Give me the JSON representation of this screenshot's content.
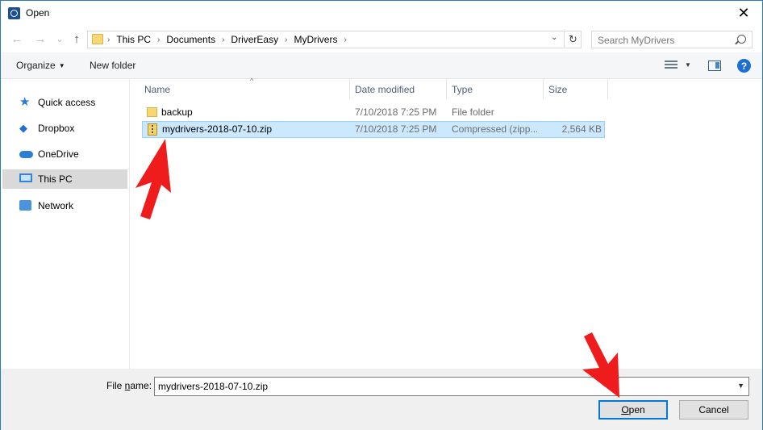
{
  "window": {
    "title": "Open",
    "close_glyph": "✕"
  },
  "nav_buttons": {
    "back": "←",
    "forward": "→",
    "recent": "⌄",
    "up": "↑"
  },
  "address": {
    "crumbs": [
      "This PC",
      "Documents",
      "DriverEasy",
      "MyDrivers"
    ],
    "separator": "›",
    "refresh_glyph": "↻"
  },
  "search": {
    "placeholder": "Search MyDrivers"
  },
  "toolbar": {
    "organize": "Organize",
    "new_folder": "New folder",
    "help": "?"
  },
  "nav_pane": {
    "items": [
      {
        "label": "Quick access",
        "icon": "star-icon"
      },
      {
        "label": "Dropbox",
        "icon": "dropbox-icon"
      },
      {
        "label": "OneDrive",
        "icon": "cloud-icon"
      },
      {
        "label": "This PC",
        "icon": "computer-icon",
        "selected": true
      },
      {
        "label": "Network",
        "icon": "network-icon"
      }
    ]
  },
  "columns": {
    "name": "Name",
    "date": "Date modified",
    "type": "Type",
    "size": "Size"
  },
  "files": [
    {
      "name": "backup",
      "date": "7/10/2018 7:25 PM",
      "type": "File folder",
      "size": "",
      "icon": "folder-icon",
      "selected": false
    },
    {
      "name": "mydrivers-2018-07-10.zip",
      "date": "7/10/2018 7:25 PM",
      "type": "Compressed (zipp...",
      "size": "2,564 KB",
      "icon": "zip-icon",
      "selected": true
    }
  ],
  "footer": {
    "file_name_label_pre": "File ",
    "file_name_label_u": "n",
    "file_name_label_post": "ame:",
    "file_name_value": "mydrivers-2018-07-10.zip",
    "open_u": "O",
    "open_rest": "pen",
    "cancel": "Cancel"
  },
  "colors": {
    "accent": "#0078d7",
    "selection": "#cce8ff",
    "annotation_arrow": "#ee1c1c"
  }
}
